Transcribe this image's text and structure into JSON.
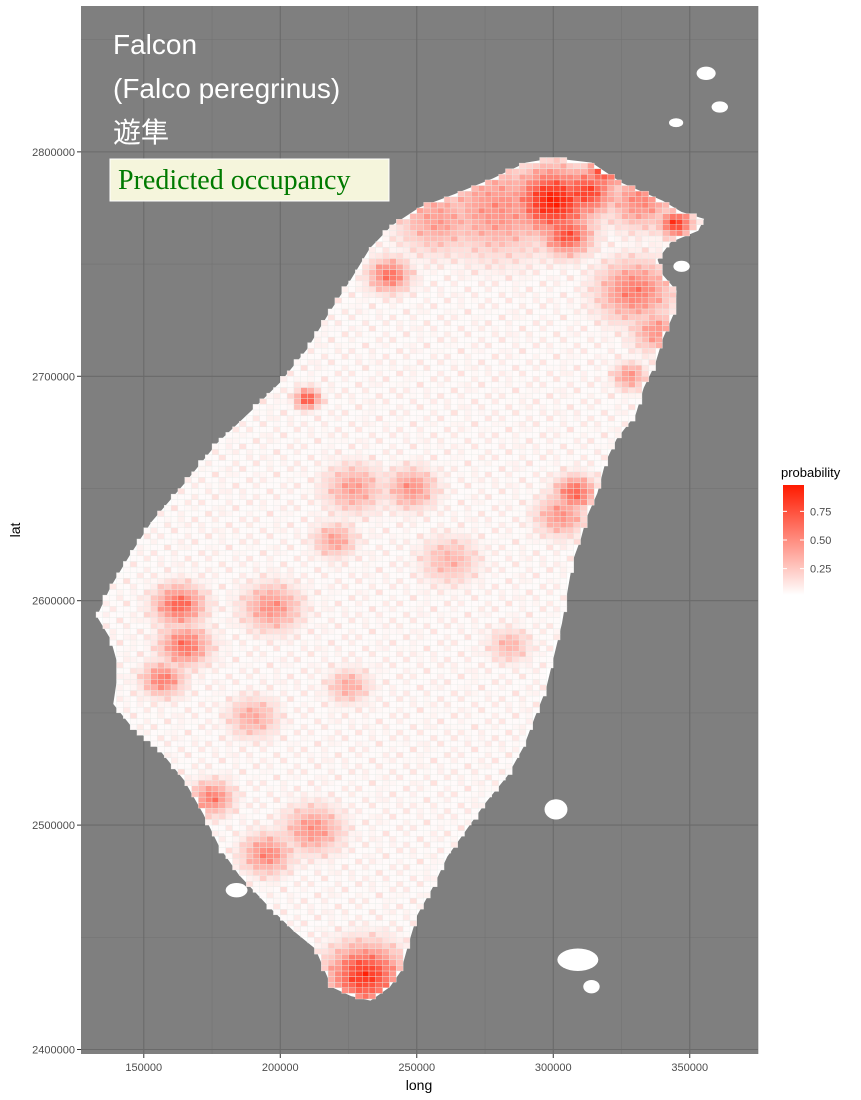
{
  "chart_data": {
    "type": "heatmap",
    "title_lines": [
      "Falcon",
      "(Falco peregrinus)",
      "遊隼"
    ],
    "badge": "Predicted occupancy",
    "xlabel": "long",
    "ylabel": "lat",
    "xlim": [
      127000,
      375000
    ],
    "ylim": [
      2398000,
      2865000
    ],
    "x_ticks": [
      150000,
      200000,
      250000,
      300000,
      350000
    ],
    "x_tick_labels": [
      "150000",
      "200000",
      "250000",
      "300000",
      "350000"
    ],
    "y_ticks": [
      2400000,
      2500000,
      2600000,
      2700000,
      2800000
    ],
    "y_tick_labels": [
      "2400000",
      "2500000",
      "2600000",
      "2700000",
      "2800000"
    ],
    "grid": true,
    "legend": {
      "title": "probability",
      "placement": "right",
      "range": [
        0.02,
        0.98
      ],
      "breaks": [
        0.25,
        0.5,
        0.75
      ],
      "labels": [
        "0.25",
        "0.50",
        "0.75"
      ],
      "low_color": "#ffffff",
      "high_color": "#ff1a00"
    },
    "cell_size_m": 2500,
    "island_outline": [
      [
        300000,
        2797000
      ],
      [
        314000,
        2795000
      ],
      [
        325000,
        2786000
      ],
      [
        340000,
        2778000
      ],
      [
        347000,
        2773000
      ],
      [
        355000,
        2770000
      ],
      [
        353000,
        2765000
      ],
      [
        343000,
        2760000
      ],
      [
        338000,
        2752000
      ],
      [
        340000,
        2745000
      ],
      [
        345000,
        2738000
      ],
      [
        344000,
        2728000
      ],
      [
        340000,
        2717000
      ],
      [
        337000,
        2705000
      ],
      [
        333000,
        2695000
      ],
      [
        330000,
        2683000
      ],
      [
        323000,
        2672000
      ],
      [
        319000,
        2662000
      ],
      [
        316000,
        2648000
      ],
      [
        312000,
        2637000
      ],
      [
        310000,
        2628000
      ],
      [
        307000,
        2618000
      ],
      [
        305000,
        2604000
      ],
      [
        303000,
        2590000
      ],
      [
        300000,
        2575000
      ],
      [
        297000,
        2560000
      ],
      [
        293000,
        2548000
      ],
      [
        289000,
        2535000
      ],
      [
        283000,
        2522000
      ],
      [
        275000,
        2510000
      ],
      [
        268000,
        2498000
      ],
      [
        261000,
        2486000
      ],
      [
        256000,
        2473000
      ],
      [
        250000,
        2460000
      ],
      [
        247000,
        2448000
      ],
      [
        244000,
        2435000
      ],
      [
        240000,
        2428000
      ],
      [
        233000,
        2422000
      ],
      [
        226000,
        2424000
      ],
      [
        219000,
        2428000
      ],
      [
        213000,
        2445000
      ],
      [
        205000,
        2453000
      ],
      [
        195000,
        2465000
      ],
      [
        185000,
        2478000
      ],
      [
        178000,
        2490000
      ],
      [
        172000,
        2505000
      ],
      [
        165000,
        2520000
      ],
      [
        155000,
        2535000
      ],
      [
        145000,
        2545000
      ],
      [
        139000,
        2554000
      ],
      [
        141000,
        2570000
      ],
      [
        138000,
        2583000
      ],
      [
        133000,
        2593000
      ],
      [
        138000,
        2606000
      ],
      [
        145000,
        2620000
      ],
      [
        153000,
        2635000
      ],
      [
        165000,
        2652000
      ],
      [
        177000,
        2670000
      ],
      [
        190000,
        2685000
      ],
      [
        200000,
        2697000
      ],
      [
        210000,
        2712000
      ],
      [
        218000,
        2728000
      ],
      [
        226000,
        2743000
      ],
      [
        233000,
        2757000
      ],
      [
        241000,
        2767000
      ],
      [
        251000,
        2775000
      ],
      [
        264000,
        2781000
      ],
      [
        278000,
        2788000
      ],
      [
        290000,
        2795000
      ]
    ],
    "islets": [
      {
        "x": 356000,
        "y": 2835000,
        "rx": 3500,
        "ry": 3000
      },
      {
        "x": 361000,
        "y": 2820000,
        "rx": 3000,
        "ry": 2500
      },
      {
        "x": 345000,
        "y": 2813000,
        "rx": 2600,
        "ry": 2000
      },
      {
        "x": 347000,
        "y": 2749000,
        "rx": 3000,
        "ry": 2500
      },
      {
        "x": 301000,
        "y": 2507000,
        "rx": 4200,
        "ry": 4500
      },
      {
        "x": 184000,
        "y": 2471000,
        "rx": 4000,
        "ry": 3200
      },
      {
        "x": 309000,
        "y": 2440000,
        "rx": 7500,
        "ry": 5000
      },
      {
        "x": 314000,
        "y": 2428000,
        "rx": 3000,
        "ry": 3000
      }
    ],
    "hotspots": [
      {
        "x": 300000,
        "y": 2778000,
        "r": 10000,
        "p": 0.95
      },
      {
        "x": 312000,
        "y": 2782000,
        "r": 7000,
        "p": 0.8
      },
      {
        "x": 305000,
        "y": 2763000,
        "r": 6000,
        "p": 0.75
      },
      {
        "x": 318000,
        "y": 2790000,
        "r": 5000,
        "p": 0.7
      },
      {
        "x": 280000,
        "y": 2775000,
        "r": 14000,
        "p": 0.45
      },
      {
        "x": 258000,
        "y": 2770000,
        "r": 10000,
        "p": 0.4
      },
      {
        "x": 332000,
        "y": 2778000,
        "r": 8000,
        "p": 0.5
      },
      {
        "x": 345000,
        "y": 2768000,
        "r": 4000,
        "p": 0.85
      },
      {
        "x": 330000,
        "y": 2738000,
        "r": 9000,
        "p": 0.55
      },
      {
        "x": 338000,
        "y": 2720000,
        "r": 6000,
        "p": 0.45
      },
      {
        "x": 240000,
        "y": 2745000,
        "r": 5000,
        "p": 0.6
      },
      {
        "x": 231000,
        "y": 2433000,
        "r": 9000,
        "p": 0.85
      },
      {
        "x": 163000,
        "y": 2598000,
        "r": 6000,
        "p": 0.65
      },
      {
        "x": 165000,
        "y": 2580000,
        "r": 6000,
        "p": 0.6
      },
      {
        "x": 157000,
        "y": 2565000,
        "r": 5000,
        "p": 0.55
      },
      {
        "x": 175000,
        "y": 2512000,
        "r": 5000,
        "p": 0.55
      },
      {
        "x": 195000,
        "y": 2487000,
        "r": 6000,
        "p": 0.5
      },
      {
        "x": 212000,
        "y": 2498000,
        "r": 7000,
        "p": 0.45
      },
      {
        "x": 210000,
        "y": 2690000,
        "r": 3000,
        "p": 0.75
      },
      {
        "x": 227000,
        "y": 2650000,
        "r": 7000,
        "p": 0.4
      },
      {
        "x": 220000,
        "y": 2627000,
        "r": 5000,
        "p": 0.4
      },
      {
        "x": 197000,
        "y": 2597000,
        "r": 7000,
        "p": 0.45
      },
      {
        "x": 248000,
        "y": 2650000,
        "r": 6000,
        "p": 0.45
      },
      {
        "x": 262000,
        "y": 2618000,
        "r": 7000,
        "p": 0.3
      },
      {
        "x": 308000,
        "y": 2648000,
        "r": 5000,
        "p": 0.65
      },
      {
        "x": 303000,
        "y": 2638000,
        "r": 6000,
        "p": 0.45
      },
      {
        "x": 328000,
        "y": 2700000,
        "r": 4000,
        "p": 0.45
      },
      {
        "x": 225000,
        "y": 2562000,
        "r": 5000,
        "p": 0.35
      },
      {
        "x": 190000,
        "y": 2548000,
        "r": 6000,
        "p": 0.35
      },
      {
        "x": 284000,
        "y": 2580000,
        "r": 5000,
        "p": 0.3
      }
    ]
  }
}
